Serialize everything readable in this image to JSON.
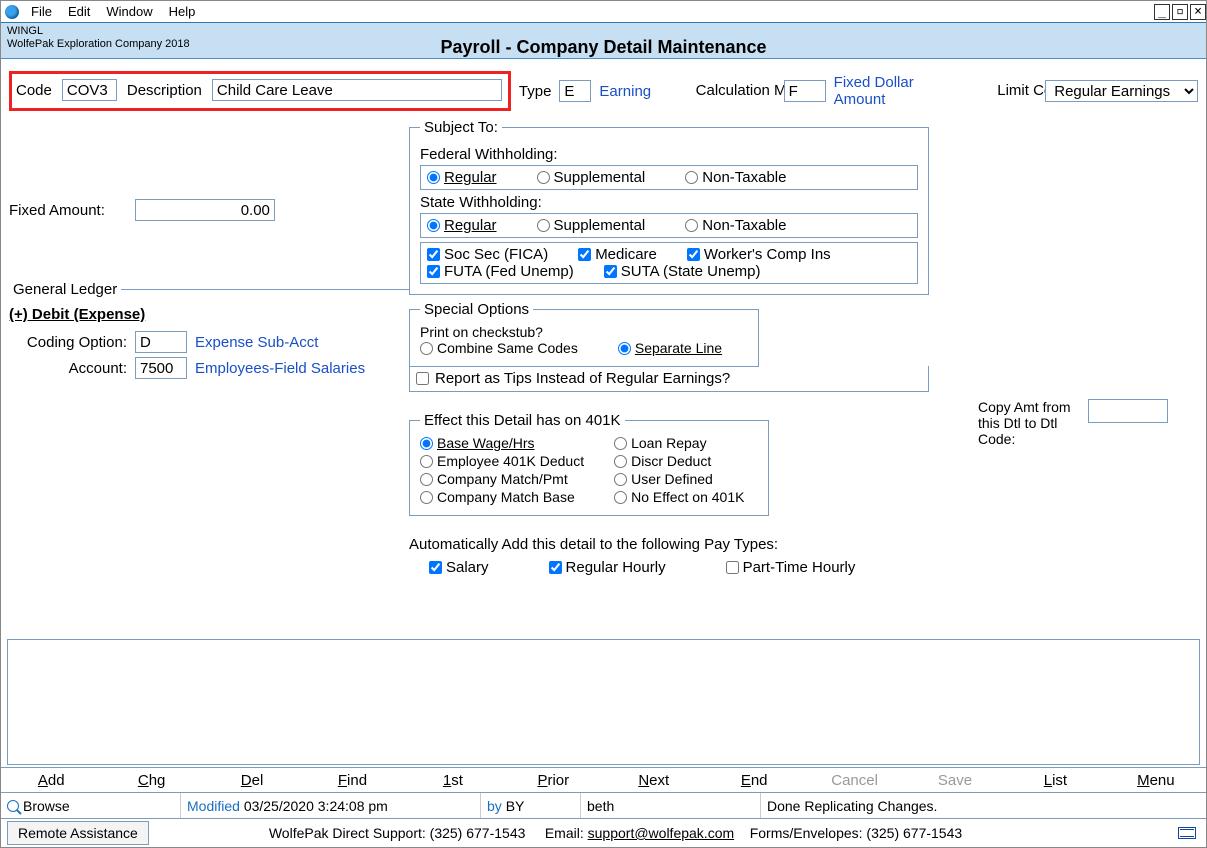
{
  "menu": {
    "file": "File",
    "edit": "Edit",
    "window": "Window",
    "help": "Help"
  },
  "win": {
    "code": "WINGL",
    "company": "WolfePak Exploration Company 2018",
    "title": "Payroll - Company Detail Maintenance"
  },
  "hdr": {
    "code_lbl": "Code",
    "code_val": "COV3",
    "desc_lbl": "Description",
    "desc_val": "Child Care Leave",
    "type_lbl": "Type",
    "type_val": "E",
    "type_link": "Earning",
    "calc_lbl": "Calculation Method",
    "calc_val": "F",
    "calc_link": "Fixed Dollar Amount",
    "limit_lbl": "Limit Code",
    "limit_val": "Regular Earnings"
  },
  "fixed": {
    "lbl": "Fixed Amount:",
    "val": "0.00"
  },
  "gl": {
    "legend": "General Ledger",
    "debit": "(+) Debit  (Expense)",
    "codopt_lbl": "Coding Option:",
    "codopt_val": "D",
    "codopt_link": "Expense Sub-Acct",
    "acct_lbl": "Account:",
    "acct_val": "7500",
    "acct_link": "Employees-Field Salaries"
  },
  "subject": {
    "legend": "Subject To:",
    "fed": "Federal Withholding:",
    "state": "State Withholding:",
    "reg": "Regular",
    "supp": "Supplemental",
    "nontax": "Non-Taxable",
    "soc": "Soc Sec (FICA)",
    "med": "Medicare",
    "wci": "Worker's Comp Ins",
    "futa": "FUTA (Fed Unemp)",
    "suta": "SUTA (State  Unemp)"
  },
  "special": {
    "legend": "Special Options",
    "stub": "Print on checkstub?",
    "combine": "Combine Same Codes",
    "sep": "Separate Line",
    "tips": "Report as Tips Instead of Regular Earnings?"
  },
  "copy": {
    "lbl": "Copy Amt from this Dtl to Dtl Code:"
  },
  "k401": {
    "legend": "Effect this Detail has on 401K",
    "base": "Base Wage/Hrs",
    "emp": "Employee 401K Deduct",
    "cmp": "Company Match/Pmt",
    "cmb": "Company Match Base",
    "loan": "Loan Repay",
    "discr": "Discr Deduct",
    "user": "User Defined",
    "none": "No Effect on 401K"
  },
  "paytypes": {
    "lbl": "Automatically Add this detail to the following Pay Types:",
    "sal": "Salary",
    "reg": "Regular Hourly",
    "pth": "Part-Time Hourly"
  },
  "toolbar": {
    "add": "Add",
    "chg": "Chg",
    "del": "Del",
    "find": "Find",
    "first": "1st",
    "prior": "Prior",
    "next": "Next",
    "end": "End",
    "cancel": "Cancel",
    "save": "Save",
    "list": "List",
    "menu": "Menu"
  },
  "status": {
    "browse": "Browse",
    "mod": "Modified",
    "dt": "03/25/2020  3:24:08 pm",
    "by": "by",
    "byval": "BY",
    "user": "beth",
    "msg": "Done Replicating Changes."
  },
  "footer": {
    "remote": "Remote Assistance",
    "support": "WolfePak Direct Support: (325) 677-1543",
    "email_lbl": "Email: ",
    "email": "support@wolfepak.com",
    "forms": "Forms/Envelopes: (325) 677-1543"
  }
}
